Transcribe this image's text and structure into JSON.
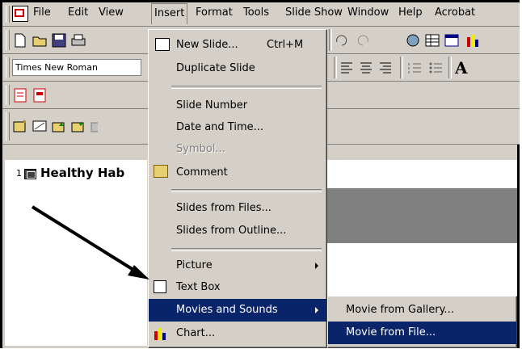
{
  "menubar": {
    "items": [
      {
        "id": "file",
        "label": "File"
      },
      {
        "id": "edit",
        "label": "Edit"
      },
      {
        "id": "view",
        "label": "View"
      },
      {
        "id": "insert",
        "label": "Insert"
      },
      {
        "id": "format",
        "label": "Format"
      },
      {
        "id": "tools",
        "label": "Tools"
      },
      {
        "id": "slideshow",
        "label": "Slide Show"
      },
      {
        "id": "window",
        "label": "Window"
      },
      {
        "id": "help",
        "label": "Help"
      },
      {
        "id": "acrobat",
        "label": "Acrobat"
      }
    ]
  },
  "formatting": {
    "font_name": "Times New Roman"
  },
  "outline": {
    "slide_number": "1",
    "slide_title": "Healthy Hab"
  },
  "insert_menu": {
    "items": [
      {
        "label": "New Slide...",
        "shortcut": "Ctrl+M"
      },
      {
        "label": "Duplicate Slide"
      },
      {
        "label": "Slide Number"
      },
      {
        "label": "Date and Time..."
      },
      {
        "label": "Symbol...",
        "disabled": true
      },
      {
        "label": "Comment"
      },
      {
        "label": "Slides from Files..."
      },
      {
        "label": "Slides from Outline..."
      },
      {
        "label": "Picture"
      },
      {
        "label": "Text Box"
      },
      {
        "label": "Movies and Sounds"
      },
      {
        "label": "Chart..."
      }
    ]
  },
  "submenu": {
    "items": [
      {
        "label": "Movie from Gallery..."
      },
      {
        "label": "Movie from File..."
      }
    ]
  },
  "colors": {
    "highlight": "#0a246a",
    "chrome": "#d4d0c8",
    "band": "#808080"
  }
}
